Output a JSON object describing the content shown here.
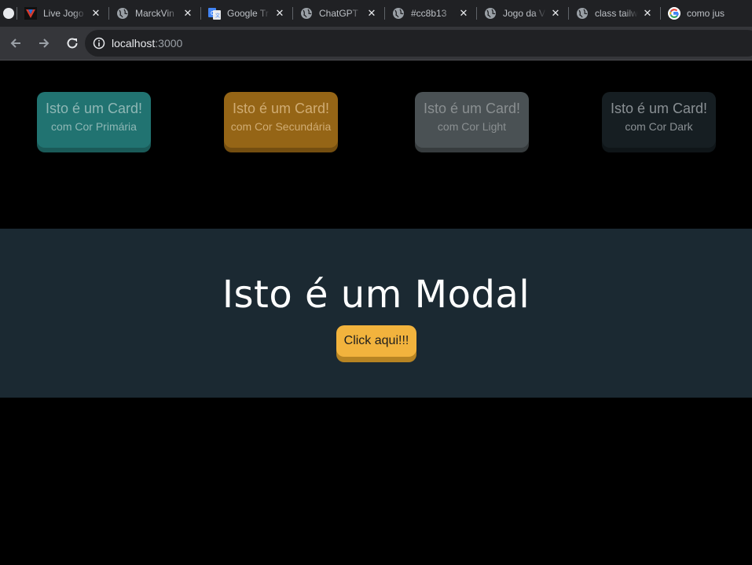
{
  "browser": {
    "tabs": [
      {
        "title": "Live Jogo",
        "icon": "v-logo-icon"
      },
      {
        "title": "MarckVin",
        "icon": "globe-icon"
      },
      {
        "title": "Google Tr",
        "icon": "google-translate-icon"
      },
      {
        "title": "ChatGPT",
        "icon": "globe-icon"
      },
      {
        "title": "#cc8b13",
        "icon": "globe-icon"
      },
      {
        "title": "Jogo da V",
        "icon": "globe-icon"
      },
      {
        "title": "class tailw",
        "icon": "globe-icon"
      },
      {
        "title": "como jus",
        "icon": "google-icon"
      }
    ],
    "close_glyph": "✕",
    "address": {
      "host": "localhost",
      "port": ":3000"
    }
  },
  "cards": [
    {
      "title": "Isto é um Card!",
      "subtitle": "com Cor Primária",
      "color": "#217371"
    },
    {
      "title": "Isto é um Card!",
      "subtitle": "com Cor Secundária",
      "color": "#956516"
    },
    {
      "title": "Isto é um Card!",
      "subtitle": "com Cor Light",
      "color": "#4a5154"
    },
    {
      "title": "Isto é um Card!",
      "subtitle": "com Cor Dark",
      "color": "#161e22"
    }
  ],
  "modal": {
    "title": "Isto é um Modal",
    "button_label": "Click aqui!!!",
    "background": "#1b2932",
    "button_color": "#f2b33d"
  }
}
